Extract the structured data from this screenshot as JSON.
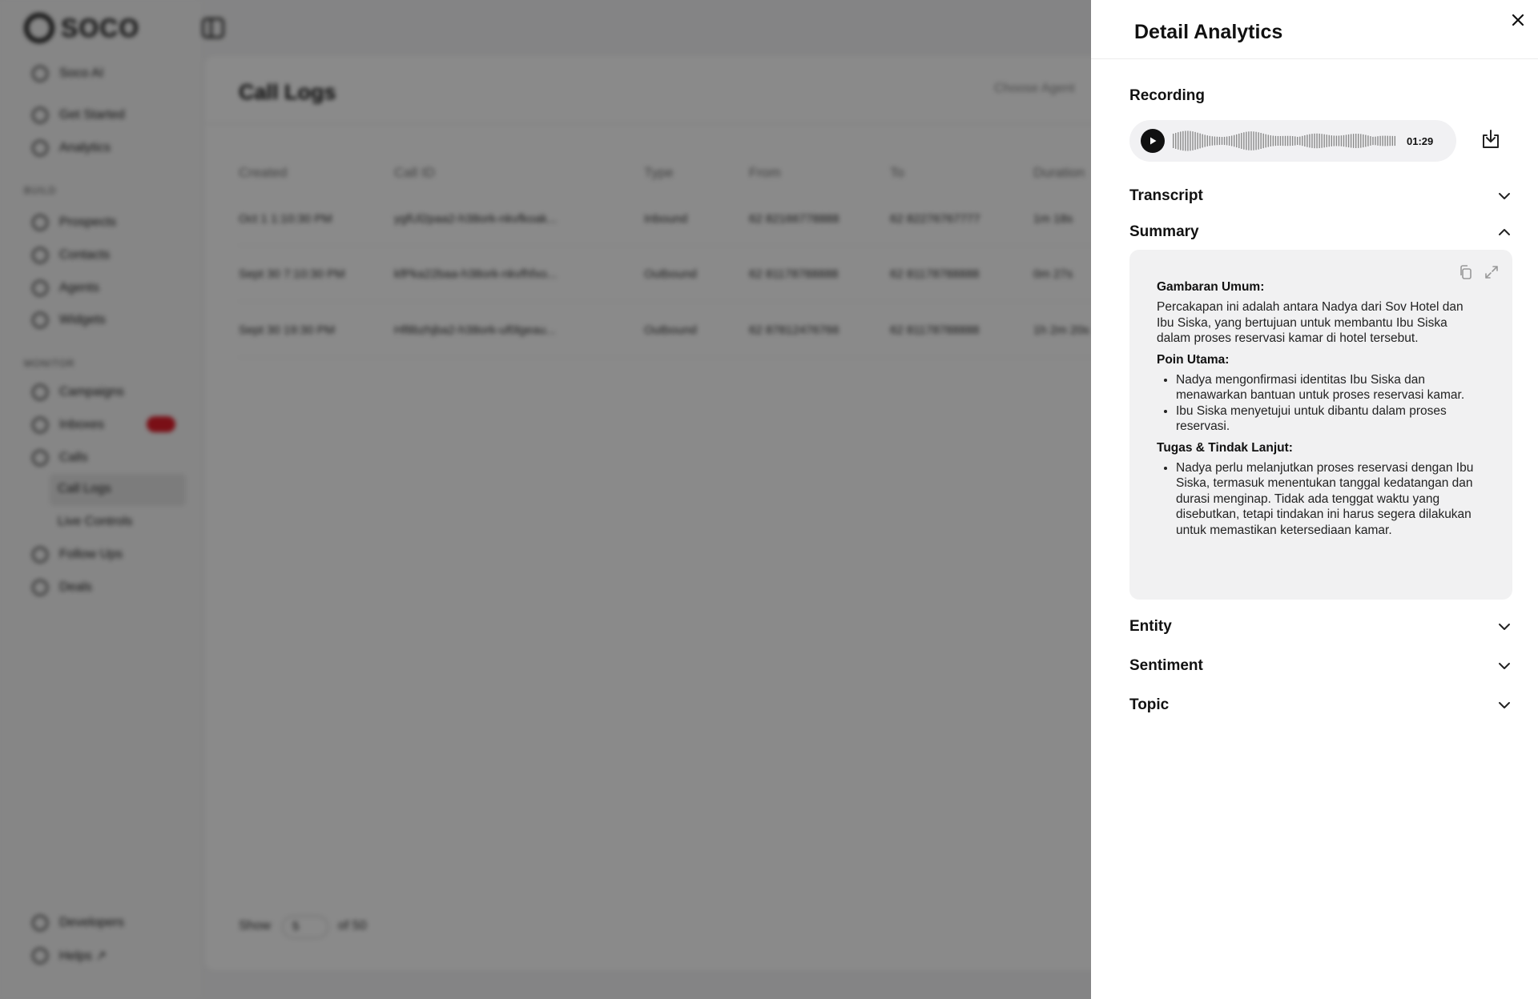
{
  "brand": {
    "name": "SOCO"
  },
  "sidebar": {
    "top_items": [
      {
        "label": "Soco AI",
        "icon": "globe-icon"
      },
      {
        "label": "Get Started",
        "icon": "rocket-icon"
      },
      {
        "label": "Analytics",
        "icon": "chart-icon"
      }
    ],
    "build_section": "BUILD",
    "build_items": [
      {
        "label": "Prospects",
        "icon": "users-icon"
      },
      {
        "label": "Contacts",
        "icon": "contacts-icon"
      },
      {
        "label": "Agents",
        "icon": "briefcase-icon"
      },
      {
        "label": "Widgets",
        "icon": "widget-icon"
      }
    ],
    "monitor_section": "MONITOR",
    "monitor_items": [
      {
        "label": "Campaigns",
        "icon": "megaphone-icon"
      },
      {
        "label": "Inboxes",
        "icon": "inbox-icon"
      },
      {
        "label": "Calls",
        "icon": "phone-icon"
      },
      {
        "label": "Call Logs",
        "icon": ""
      },
      {
        "label": "Live Controls",
        "icon": ""
      },
      {
        "label": "Follow Ups",
        "icon": "follow-icon"
      },
      {
        "label": "Deals",
        "icon": "dollar-icon"
      }
    ],
    "bottom_items": [
      {
        "label": "Developers",
        "icon": "code-icon"
      },
      {
        "label": "Helps ↗",
        "icon": "help-icon"
      }
    ]
  },
  "main": {
    "title": "Call Logs",
    "agent_filter_placeholder": "Choose Agent",
    "columns": [
      "Created",
      "Call ID",
      "Type",
      "From",
      "To",
      "Duration"
    ],
    "rows": [
      [
        "Oct 1 1:10:30 PM",
        "ygfUl2paa2-h38ork-nkvfkoak...",
        "Inbound",
        "62 82166778888",
        "62 82276767777",
        "1m 18s"
      ],
      [
        "Sept 30 7:10:30 PM",
        "kfPka22baa-h38ork-nkvfhfxo...",
        "Outbound",
        "62 81178788888",
        "62 81178788888",
        "0m 27s"
      ],
      [
        "Sept 30 19:30 PM",
        "Hf8bzhjba2-h38ork-uf0lgeau...",
        "Outbound",
        "62 87812476766",
        "62 81178788888",
        "1h 2m 20s"
      ]
    ],
    "show_label": "Show",
    "show_value": "5",
    "of_label": "of 50"
  },
  "drawer": {
    "title": "Detail Analytics",
    "recording": {
      "label": "Recording",
      "duration": "01:29"
    },
    "sections": {
      "transcript": "Transcript",
      "summary": "Summary",
      "entity": "Entity",
      "sentiment": "Sentiment",
      "topic": "Topic"
    },
    "summary": {
      "overview_heading": "Gambaran Umum:",
      "overview_text": "Percakapan ini adalah antara Nadya dari Sov Hotel dan Ibu Siska, yang bertujuan untuk membantu Ibu Siska dalam proses reservasi kamar di hotel tersebut.",
      "main_points_heading": "Poin Utama:",
      "main_points": [
        "Nadya mengonfirmasi identitas Ibu Siska dan menawarkan bantuan untuk proses reservasi kamar.",
        "Ibu Siska menyetujui untuk dibantu dalam proses reservasi."
      ],
      "tasks_heading": "Tugas & Tindak Lanjut:",
      "tasks": [
        "Nadya perlu melanjutkan proses reservasi dengan Ibu Siska, termasuk menentukan tanggal kedatangan dan durasi menginap. Tidak ada tenggat waktu yang disebutkan, tetapi tindakan ini harus segera dilakukan untuk memastikan ketersediaan kamar."
      ]
    }
  },
  "colors": {
    "overlay": "#000000",
    "badge": "#e11d2a",
    "summary_bg": "#f1f1f2"
  }
}
